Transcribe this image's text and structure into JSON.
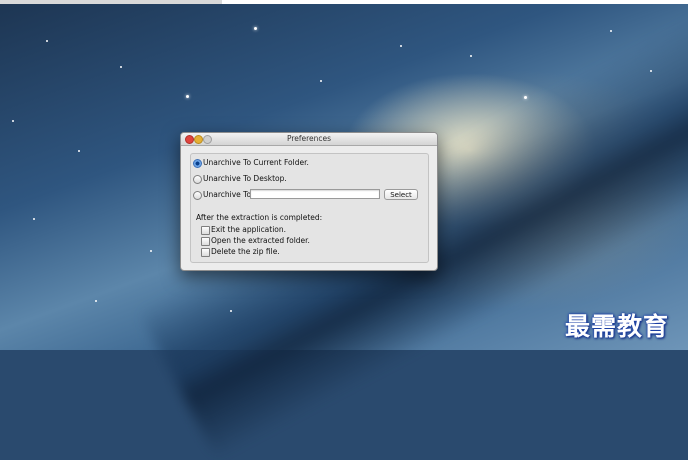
{
  "window": {
    "title": "Preferences"
  },
  "options": {
    "radio_current": "Unarchive To Current Folder.",
    "radio_desktop": "Unarchive To Desktop.",
    "radio_to": "Unarchive To:",
    "path_value": "",
    "select_button": "Select",
    "selected": "current"
  },
  "after": {
    "heading": "After the extraction is completed:",
    "exit": "Exit the application.",
    "open": "Open the extracted folder.",
    "delete": "Delete the zip file."
  },
  "watermark": {
    "text": "最需教育"
  }
}
